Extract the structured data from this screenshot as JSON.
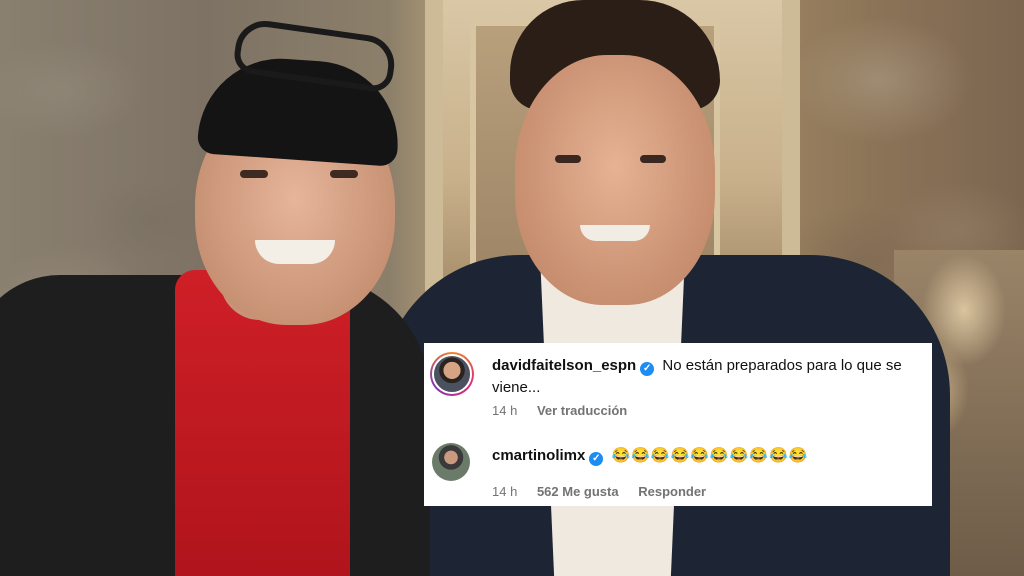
{
  "comments": [
    {
      "username": "davidfaitelson_espn",
      "verified": true,
      "text": "No están preparados para lo que se viene...",
      "time": "14 h",
      "actions": [
        "Ver traducción"
      ]
    },
    {
      "username": "cmartinolimx",
      "verified": true,
      "text": "😂😂😂😂😂😂😂😂😂😂",
      "time": "14 h",
      "likes": "562 Me gusta",
      "actions": [
        "Responder"
      ]
    }
  ],
  "icons": {
    "verified": "verified-badge-icon"
  },
  "colors": {
    "verified_blue": "#1d8cf3",
    "meta_gray": "#737373",
    "card_bg": "#ffffff"
  }
}
